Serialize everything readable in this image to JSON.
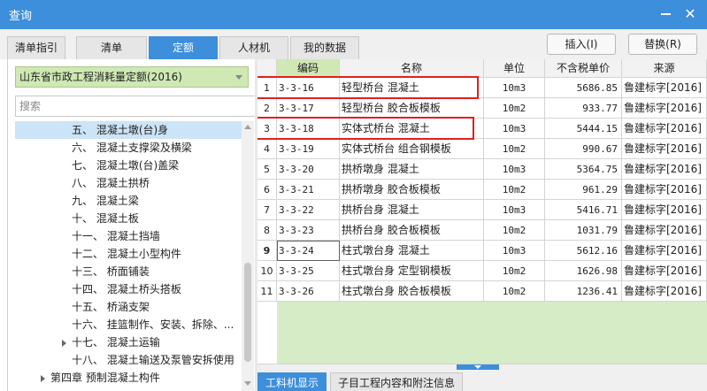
{
  "window": {
    "title": "查询",
    "minimize_label": "",
    "close_label": "✕"
  },
  "tabs": [
    {
      "label": "清单指引",
      "active": false
    },
    {
      "label": "清单",
      "active": false
    },
    {
      "label": "定额",
      "active": true
    },
    {
      "label": "人材机",
      "active": false
    },
    {
      "label": "我的数据",
      "active": false
    }
  ],
  "actions": {
    "insert_label": "插入(I)",
    "replace_label": "替换(R)"
  },
  "left": {
    "library": "山东省市政工程消耗量定额(2016)",
    "search_placeholder": "搜索",
    "tree": [
      {
        "label": "五、 混凝土墩(台)身",
        "selected": true,
        "expander": false
      },
      {
        "label": "六、 混凝土支撑梁及横梁",
        "selected": false,
        "expander": false
      },
      {
        "label": "七、 混凝土墩(台)盖梁",
        "selected": false,
        "expander": false
      },
      {
        "label": "八、 混凝土拱桥",
        "selected": false,
        "expander": false
      },
      {
        "label": "九、 混凝土梁",
        "selected": false,
        "expander": false
      },
      {
        "label": "十、 混凝土板",
        "selected": false,
        "expander": false
      },
      {
        "label": "十一、 混凝土挡墙",
        "selected": false,
        "expander": false
      },
      {
        "label": "十二、 混凝土小型构件",
        "selected": false,
        "expander": false
      },
      {
        "label": "十三、 桥面铺装",
        "selected": false,
        "expander": false
      },
      {
        "label": "十四、 混凝土桥头搭板",
        "selected": false,
        "expander": false
      },
      {
        "label": "十五、 桥涵支架",
        "selected": false,
        "expander": false
      },
      {
        "label": "十六、 挂篮制作、安装、拆除、...",
        "selected": false,
        "expander": false
      },
      {
        "label": "十七、 混凝土运输",
        "selected": false,
        "expander": true
      },
      {
        "label": "十八、 混凝土输送及泵管安拆使用",
        "selected": false,
        "expander": false
      },
      {
        "label": "第四章 预制混凝土构件",
        "selected": false,
        "expander": true
      }
    ]
  },
  "grid": {
    "headers": [
      "",
      "编码",
      "名称",
      "单位",
      "不含税单价",
      "来源"
    ],
    "rows": [
      {
        "num": "1",
        "code": "3-3-16",
        "name": "轻型桥台 混凝土",
        "unit": "10m3",
        "price": "5686.85",
        "source": "鲁建标字[2016]"
      },
      {
        "num": "2",
        "code": "3-3-17",
        "name": "轻型桥台 胶合板模板",
        "unit": "10m2",
        "price": "933.77",
        "source": "鲁建标字[2016]"
      },
      {
        "num": "3",
        "code": "3-3-18",
        "name": "实体式桥台 混凝土",
        "unit": "10m3",
        "price": "5444.15",
        "source": "鲁建标字[2016]"
      },
      {
        "num": "4",
        "code": "3-3-19",
        "name": "实体式桥台 组合钢模板",
        "unit": "10m2",
        "price": "990.67",
        "source": "鲁建标字[2016]"
      },
      {
        "num": "5",
        "code": "3-3-20",
        "name": "拱桥墩身 混凝土",
        "unit": "10m3",
        "price": "5364.75",
        "source": "鲁建标字[2016]"
      },
      {
        "num": "6",
        "code": "3-3-21",
        "name": "拱桥墩身 胶合板模板",
        "unit": "10m2",
        "price": "961.29",
        "source": "鲁建标字[2016]"
      },
      {
        "num": "7",
        "code": "3-3-22",
        "name": "拱桥台身 混凝土",
        "unit": "10m3",
        "price": "5416.71",
        "source": "鲁建标字[2016]"
      },
      {
        "num": "8",
        "code": "3-3-23",
        "name": "拱桥台身 胶合板模板",
        "unit": "10m2",
        "price": "1031.79",
        "source": "鲁建标字[2016]"
      },
      {
        "num": "9",
        "code": "3-3-24",
        "name": "柱式墩台身 混凝土",
        "unit": "10m3",
        "price": "5612.16",
        "source": "鲁建标字[2016]"
      },
      {
        "num": "10",
        "code": "3-3-25",
        "name": "柱式墩台身 定型钢模板",
        "unit": "10m2",
        "price": "1626.98",
        "source": "鲁建标字[2016]"
      },
      {
        "num": "11",
        "code": "3-3-26",
        "name": "柱式墩台身 胶合板模板",
        "unit": "10m2",
        "price": "1236.41",
        "source": "鲁建标字[2016]"
      }
    ]
  },
  "bottom_tabs": [
    {
      "label": "工料机显示",
      "active": true
    },
    {
      "label": "子目工程内容和附注信息",
      "active": false
    }
  ]
}
